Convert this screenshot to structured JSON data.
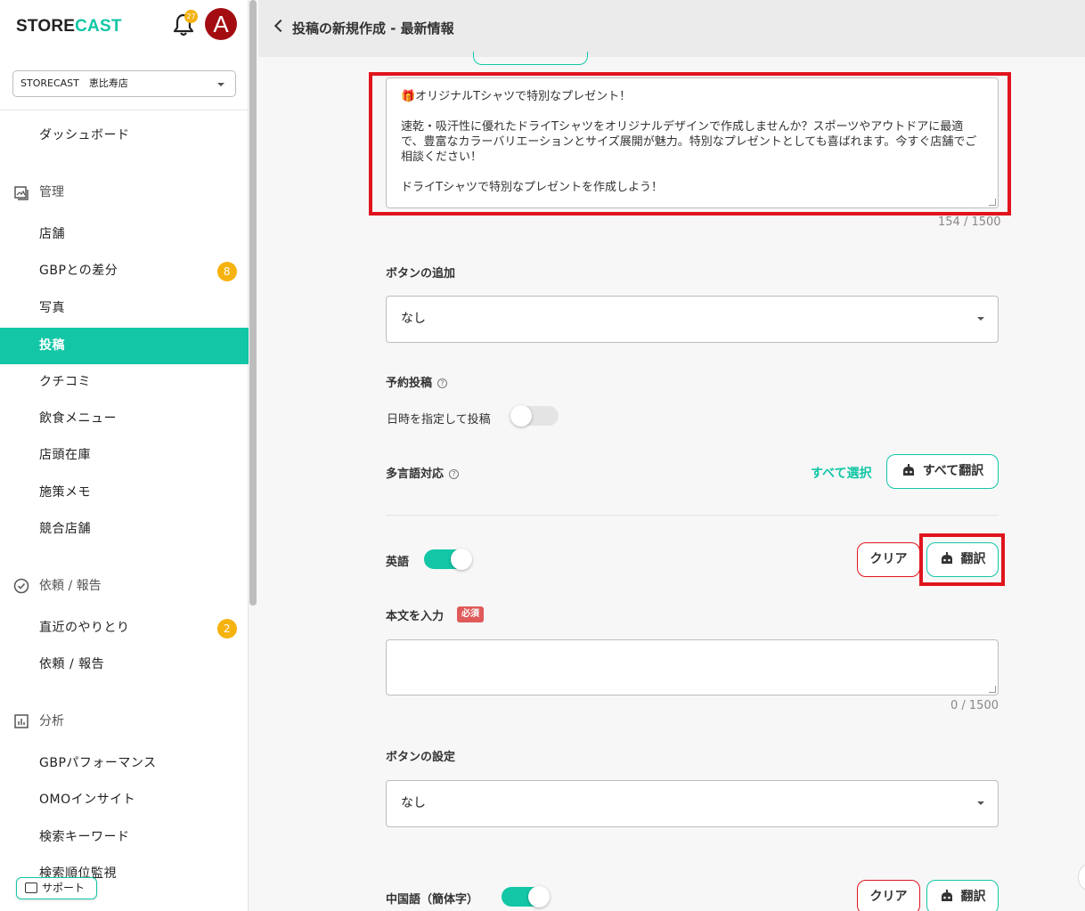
{
  "sidebar": {
    "logo_store": "STORE",
    "logo_cast": "CAST",
    "notification_count": "27",
    "avatar_letter": "A",
    "store_selector": "STORECAST　恵比寿店",
    "dashboard": "ダッシュボード",
    "sections": {
      "manage": "管理",
      "requests": "依頼 / 報告",
      "analysis": "分析"
    },
    "items": {
      "store": "店舗",
      "gbp_diff": "GBPとの差分",
      "gbp_diff_badge": "8",
      "photos": "写真",
      "posts": "投稿",
      "reviews": "クチコミ",
      "menu": "飲食メニュー",
      "inventory": "店頭在庫",
      "memo": "施策メモ",
      "competitors": "競合店舗",
      "recent": "直近のやりとり",
      "recent_badge": "2",
      "requests": "依頼 / 報告",
      "gbp_performance": "GBPパフォーマンス",
      "omo": "OMOインサイト",
      "keywords": "検索キーワード",
      "rank": "検索順位監視"
    },
    "support": "サポート"
  },
  "header": {
    "title": "投稿の新規作成 - 最新情報"
  },
  "form": {
    "body_text": "🎁オリジナルTシャツで特別なプレゼント！\n\n速乾・吸汗性に優れたドライTシャツをオリジナルデザインで作成しませんか？スポーツやアウトドアに最適で、豊富なカラーバリエーションとサイズ展開が魅力。特別なプレゼントとしても喜ばれます。今すぐ店舗でご相談ください！\n\nドライTシャツで特別なプレゼントを作成しよう！",
    "body_counter": "154 / 1500",
    "add_button_label": "ボタンの追加",
    "add_button_value": "なし",
    "schedule_label": "予約投稿",
    "schedule_toggle_label": "日時を指定して投稿",
    "schedule_enabled": false,
    "multilang_label": "多言語対応",
    "select_all": "すべて選択",
    "translate_all": "すべて翻訳",
    "english": {
      "label": "英語",
      "enabled": true,
      "clear": "クリア",
      "translate": "翻訳",
      "body_label": "本文を入力",
      "required": "必須",
      "counter": "0 / 1500",
      "button_label": "ボタンの設定",
      "button_value": "なし"
    },
    "chinese": {
      "label": "中国語（簡体字）",
      "enabled": true,
      "clear": "クリア",
      "translate": "翻訳"
    }
  },
  "colors": {
    "accent": "#12c6a6",
    "highlight": "#e0141d",
    "badge": "#f6b20e",
    "avatar": "#a30d11"
  }
}
